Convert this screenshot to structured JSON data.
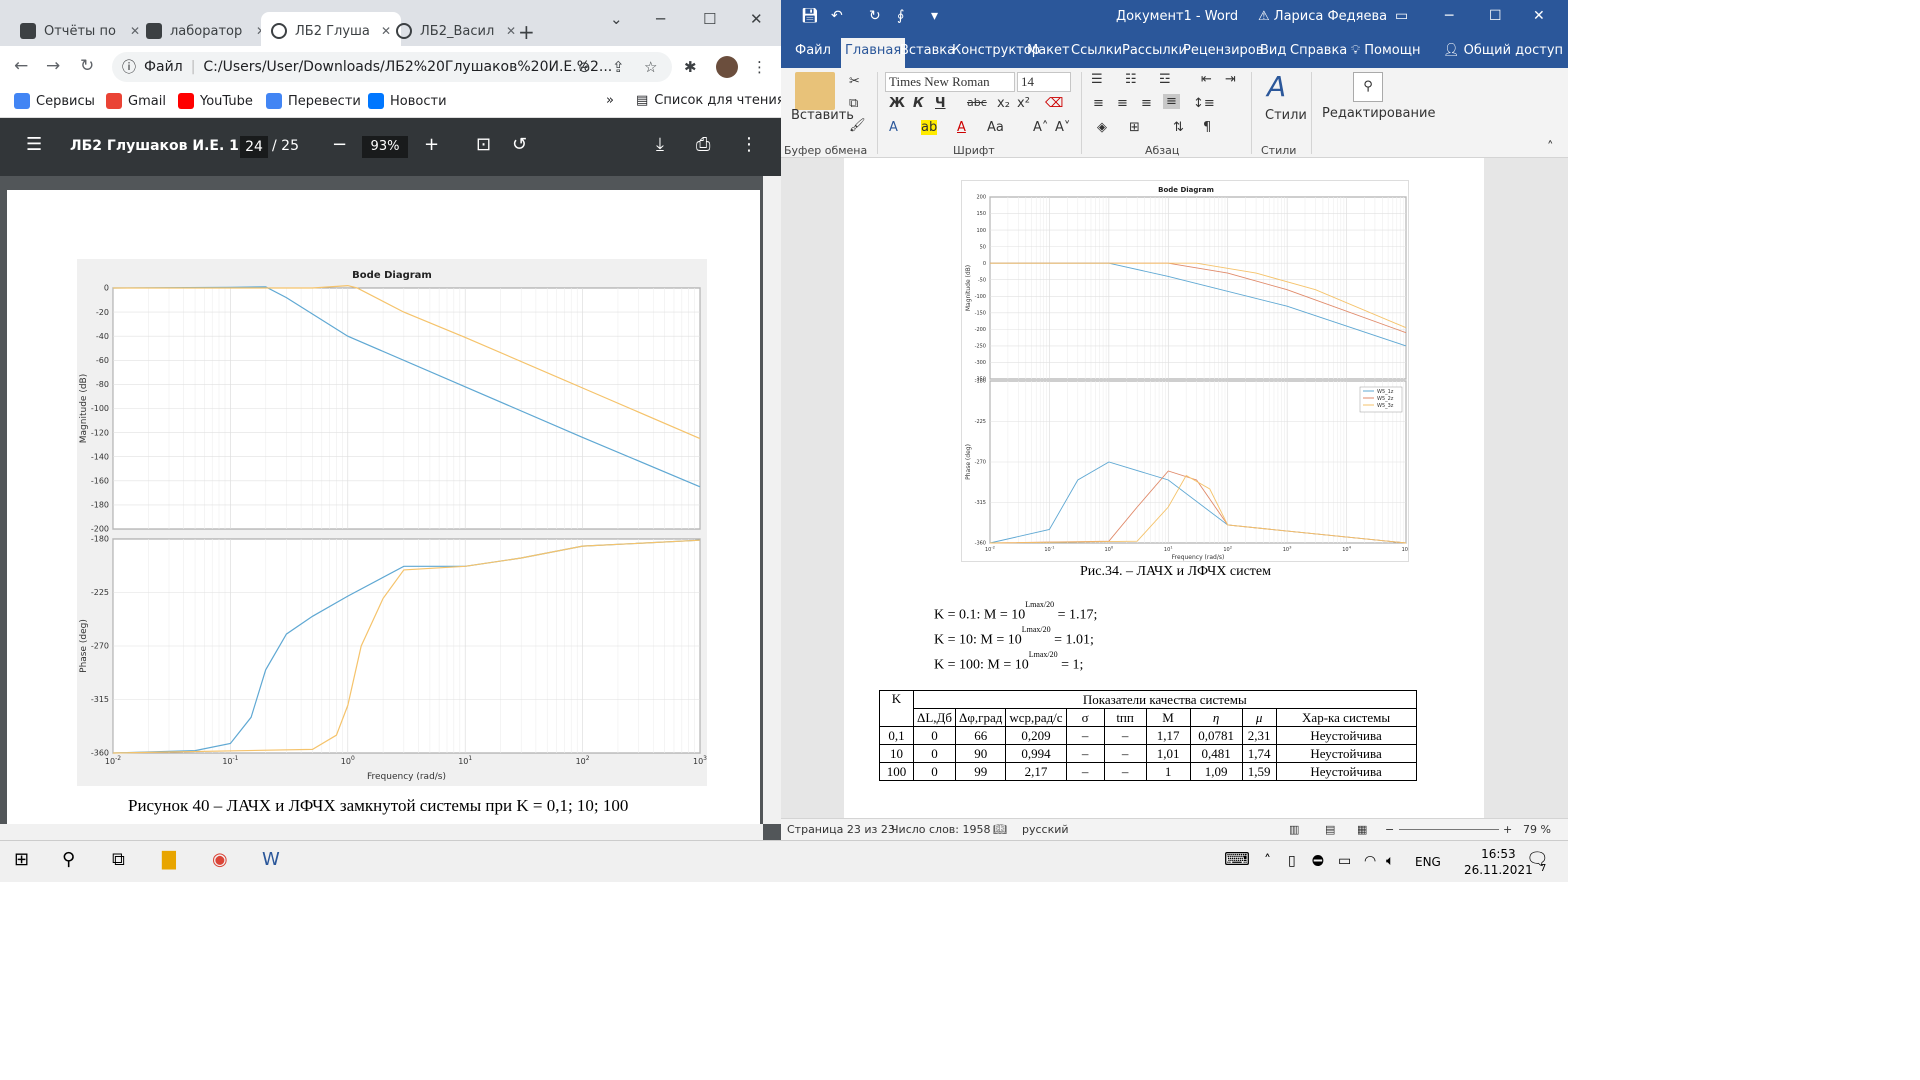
{
  "browser": {
    "tabs": [
      {
        "title": "Отчёты по"
      },
      {
        "title": "лаборатор"
      },
      {
        "title": "ЛБ2 Глуша"
      },
      {
        "title": "ЛБ2_Васил"
      }
    ],
    "address_scheme": "Файл",
    "address": "C:/Users/User/Downloads/ЛБ2%20Глушаков%20И.Е.%2...",
    "bookmarks": [
      "Сервисы",
      "Gmail",
      "YouTube",
      "Перевести",
      "Новости"
    ],
    "reading_list": "Список для чтения",
    "more_bookmarks": "»",
    "pdf": {
      "title": "ЛБ2 Глушаков И.Е. 1...",
      "page": "24",
      "total": "/ 25",
      "zoom": "93%",
      "figure_caption": "Рисунок 40 – ЛАЧХ и ЛФЧХ замкнутой системы при K = 0,1; 10; 100"
    }
  },
  "word": {
    "doc_title": "Документ1 - Word",
    "user": "Лариса Федяева",
    "menu": [
      "Файл",
      "Главная",
      "Вставка",
      "Конструктор",
      "Макет",
      "Ссылки",
      "Рассылки",
      "Рецензиров",
      "Вид",
      "Справка",
      "Помощн",
      "Общий доступ"
    ],
    "ribbon": {
      "paste": "Вставить",
      "font_name": "Times New Roman",
      "font_size": "14",
      "bold": "Ж",
      "italic": "К",
      "underline": "Ч",
      "case": "Аа",
      "styles": "Стили",
      "editing": "Редактирование",
      "groups": [
        "Буфер обмена",
        "Шрифт",
        "Абзац",
        "Стили"
      ]
    },
    "figure_caption": "Рис.34. – ЛАЧХ и ЛФЧХ систем",
    "m_lines": [
      {
        "pre": "K = 0.1: M = 10",
        "exp": "Lmax/20",
        "post": " = 1.17;"
      },
      {
        "pre": "K = 10: M = 10",
        "exp": "Lmax/20",
        "post": " = 1.01;"
      },
      {
        "pre": "K = 100: M = 10",
        "exp": "Lmax/20",
        "post": " = 1;"
      }
    ],
    "table": {
      "k_header": "K",
      "group_header": "Показатели качества системы",
      "columns": [
        "ΔL,Дб",
        "Δφ,град",
        "wср,рад/с",
        "σ",
        "tпп",
        "M",
        "η",
        "μ",
        "Хар-ка системы"
      ],
      "rows": [
        [
          "0,1",
          "0",
          "66",
          "0,209",
          "–",
          "–",
          "1,17",
          "0,0781",
          "2,31",
          "Неустойчива"
        ],
        [
          "10",
          "0",
          "90",
          "0,994",
          "–",
          "–",
          "1,01",
          "0,481",
          "1,74",
          "Неустойчива"
        ],
        [
          "100",
          "0",
          "99",
          "2,17",
          "–",
          "–",
          "1",
          "1,09",
          "1,59",
          "Неустойчива"
        ]
      ]
    },
    "status": {
      "page": "Страница 23 из 23",
      "words": "Число слов: 1958",
      "lang": "русский",
      "zoom": "79 %"
    }
  },
  "taskbar": {
    "lang": "ENG",
    "time": "16:53",
    "date": "26.11.2021",
    "notifications": "7"
  },
  "chart_data": [
    {
      "type": "line",
      "title": "Bode Diagram",
      "xlabel": "Frequency (rad/s)",
      "xscale": "log",
      "xlim": [
        0.01,
        1000
      ],
      "panels": [
        {
          "ylabel": "Magnitude (dB)",
          "ylim": [
            -200,
            0
          ],
          "yticks": [
            0,
            -20,
            -40,
            -60,
            -80,
            -100,
            -120,
            -140,
            -160,
            -180,
            -200
          ],
          "series": [
            {
              "color": "#5fa8d3",
              "points": [
                [
                  0.01,
                  0
                ],
                [
                  0.1,
                  0.5
                ],
                [
                  0.2,
                  1
                ],
                [
                  0.3,
                  -8
                ],
                [
                  1,
                  -40
                ],
                [
                  10,
                  -82
                ],
                [
                  100,
                  -124
                ],
                [
                  1000,
                  -165
                ]
              ]
            },
            {
              "color": "#f5c36b",
              "points": [
                [
                  0.01,
                  0
                ],
                [
                  0.5,
                  0
                ],
                [
                  1,
                  2
                ],
                [
                  1.2,
                  0
                ],
                [
                  3,
                  -20
                ],
                [
                  10,
                  -41
                ],
                [
                  100,
                  -83
                ],
                [
                  1000,
                  -125
                ]
              ]
            }
          ]
        },
        {
          "ylabel": "Phase (deg)",
          "ylim": [
            -360,
            -180
          ],
          "yticks": [
            -180,
            -225,
            -270,
            -315,
            -360
          ],
          "series": [
            {
              "color": "#5fa8d3",
              "points": [
                [
                  0.01,
                  -360
                ],
                [
                  0.05,
                  -358
                ],
                [
                  0.1,
                  -352
                ],
                [
                  0.15,
                  -330
                ],
                [
                  0.2,
                  -290
                ],
                [
                  0.3,
                  -260
                ],
                [
                  0.5,
                  -245
                ],
                [
                  1,
                  -228
                ],
                [
                  3,
                  -203
                ],
                [
                  10,
                  -203
                ],
                [
                  30,
                  -196
                ],
                [
                  100,
                  -186
                ],
                [
                  1000,
                  -181
                ]
              ]
            },
            {
              "color": "#f5c36b",
              "points": [
                [
                  0.01,
                  -360
                ],
                [
                  0.5,
                  -357
                ],
                [
                  0.8,
                  -345
                ],
                [
                  1,
                  -320
                ],
                [
                  1.3,
                  -270
                ],
                [
                  2,
                  -230
                ],
                [
                  3,
                  -206
                ],
                [
                  10,
                  -203
                ],
                [
                  30,
                  -196
                ],
                [
                  100,
                  -186
                ],
                [
                  1000,
                  -181
                ]
              ]
            }
          ]
        }
      ]
    },
    {
      "type": "line",
      "title": "Bode Diagram",
      "xlabel": "Frequency (rad/s)",
      "xscale": "log",
      "xlim": [
        0.01,
        100000
      ],
      "legend": [
        "W5_1z",
        "W5_2z",
        "W5_3z"
      ],
      "legend_position": "top-right",
      "panels": [
        {
          "ylabel": "Magnitude (dB)",
          "ylim": [
            -350,
            200
          ],
          "yticks": [
            200,
            150,
            100,
            50,
            0,
            -50,
            -100,
            -150,
            -200,
            -250,
            -300,
            -350
          ],
          "series": [
            {
              "color": "#5fa8d3",
              "points": [
                [
                  0.01,
                  0
                ],
                [
                  1,
                  0
                ],
                [
                  10,
                  -40
                ],
                [
                  1000,
                  -130
                ],
                [
                  100000,
                  -250
                ]
              ]
            },
            {
              "color": "#e08a6a",
              "points": [
                [
                  0.01,
                  0
                ],
                [
                  10,
                  0
                ],
                [
                  100,
                  -30
                ],
                [
                  1000,
                  -80
                ],
                [
                  100000,
                  -210
                ]
              ]
            },
            {
              "color": "#f5c36b",
              "points": [
                [
                  0.01,
                  0
                ],
                [
                  30,
                  0
                ],
                [
                  300,
                  -30
                ],
                [
                  3000,
                  -80
                ],
                [
                  100000,
                  -195
                ]
              ]
            }
          ]
        },
        {
          "ylabel": "Phase (deg)",
          "ylim": [
            -360,
            -180
          ],
          "yticks": [
            -180,
            -225,
            -270,
            -315,
            -360
          ],
          "series": [
            {
              "color": "#5fa8d3",
              "points": [
                [
                  0.01,
                  -360
                ],
                [
                  0.1,
                  -345
                ],
                [
                  0.3,
                  -290
                ],
                [
                  1,
                  -270
                ],
                [
                  10,
                  -290
                ],
                [
                  100,
                  -340
                ],
                [
                  100000,
                  -360
                ]
              ]
            },
            {
              "color": "#e08a6a",
              "points": [
                [
                  0.01,
                  -360
                ],
                [
                  1,
                  -358
                ],
                [
                  3,
                  -320
                ],
                [
                  10,
                  -280
                ],
                [
                  30,
                  -290
                ],
                [
                  100,
                  -340
                ],
                [
                  100000,
                  -360
                ]
              ]
            },
            {
              "color": "#f5c36b",
              "points": [
                [
                  0.01,
                  -360
                ],
                [
                  3,
                  -358
                ],
                [
                  10,
                  -320
                ],
                [
                  20,
                  -285
                ],
                [
                  50,
                  -300
                ],
                [
                  100,
                  -340
                ],
                [
                  100000,
                  -360
                ]
              ]
            }
          ]
        }
      ]
    }
  ]
}
